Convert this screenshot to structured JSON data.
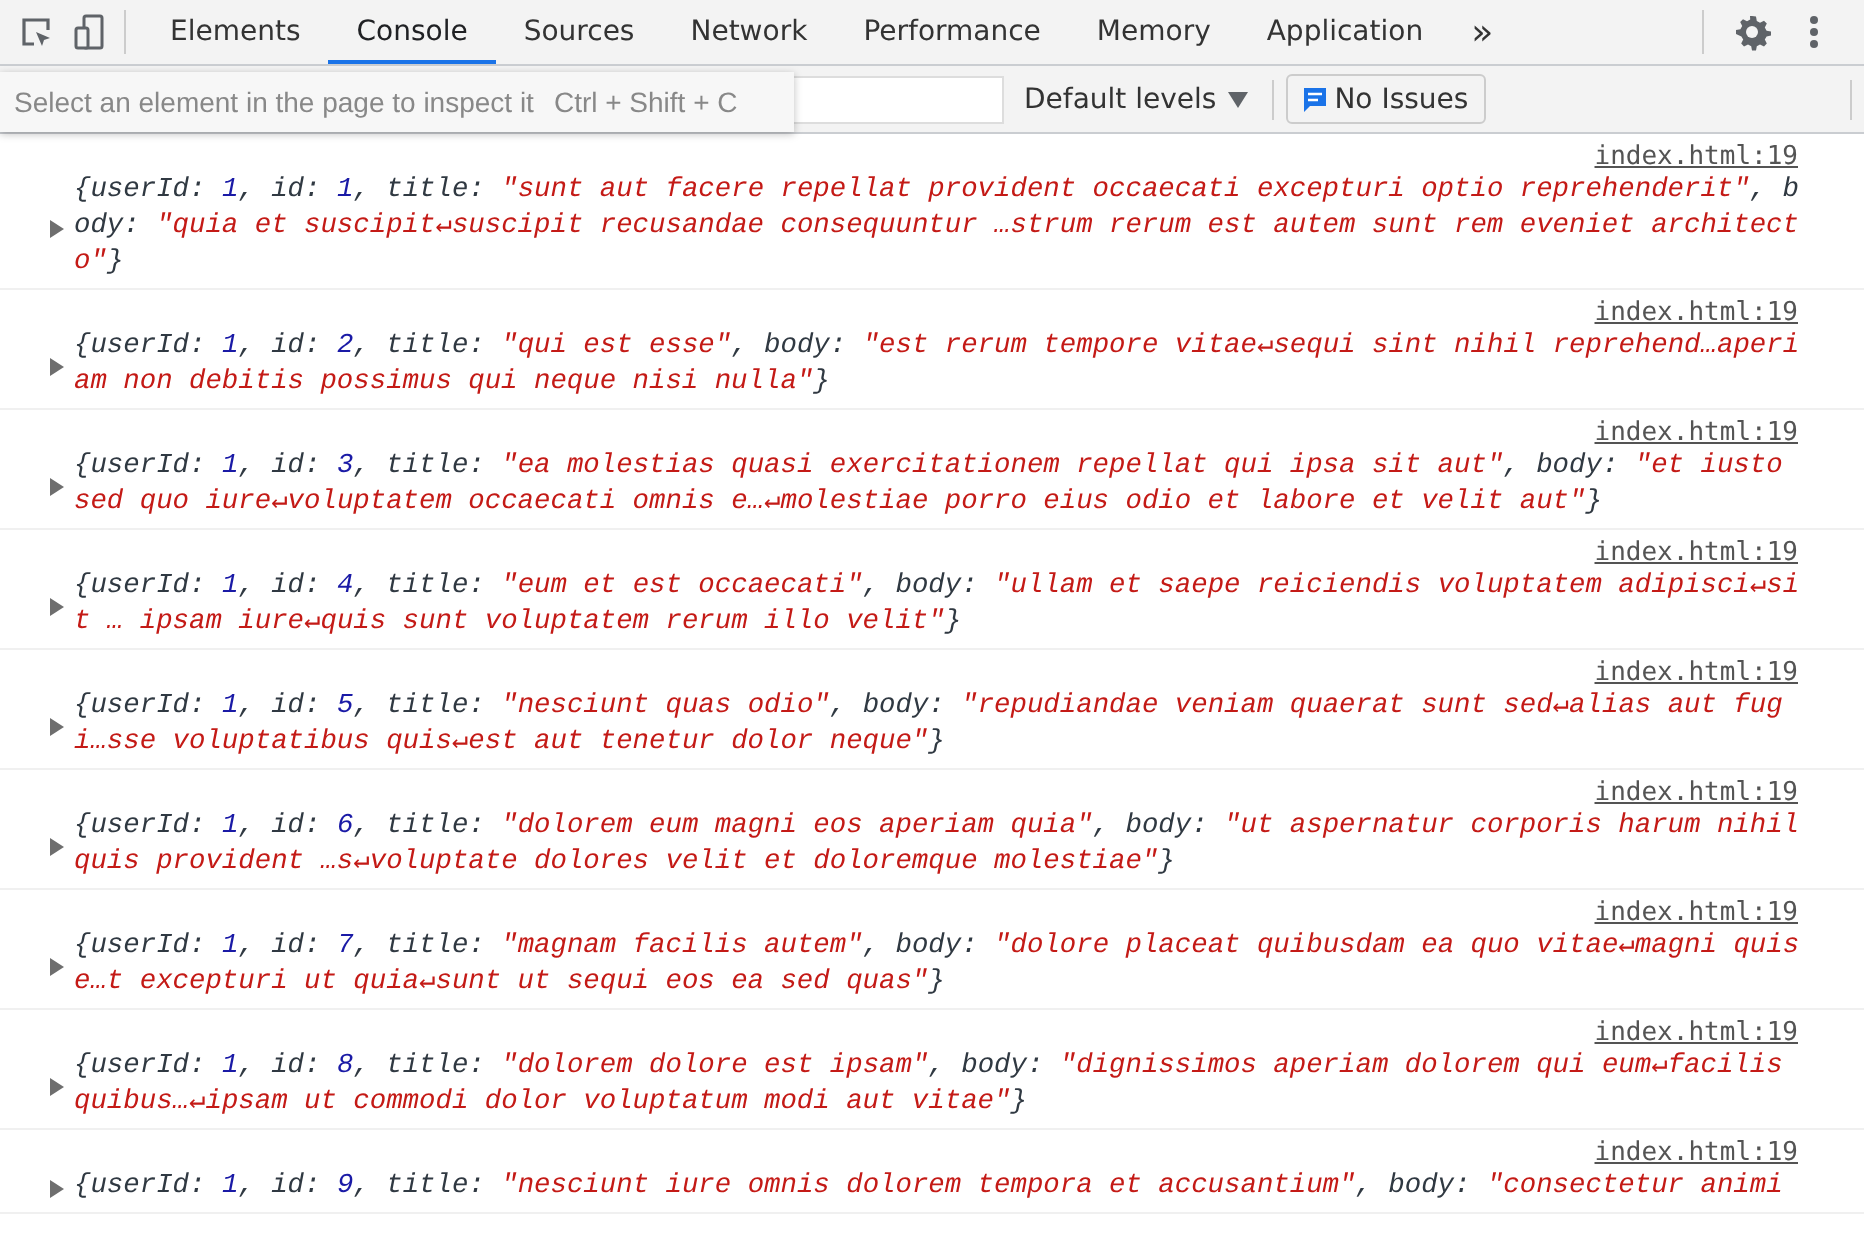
{
  "tabs": [
    {
      "label": "Elements",
      "selected": false
    },
    {
      "label": "Console",
      "selected": true
    },
    {
      "label": "Sources",
      "selected": false
    },
    {
      "label": "Network",
      "selected": false
    },
    {
      "label": "Performance",
      "selected": false
    },
    {
      "label": "Memory",
      "selected": false
    },
    {
      "label": "Application",
      "selected": false
    }
  ],
  "overflow": "»",
  "toolbar": {
    "levels": "Default levels",
    "issues": "No Issues"
  },
  "tooltip": {
    "text": "Select an element in the page to inspect it",
    "shortcut": "Ctrl + Shift + C"
  },
  "messages": [
    {
      "source": "index.html:19",
      "parts": [
        {
          "kind": "key",
          "text": "{userId: "
        },
        {
          "kind": "number",
          "text": "1"
        },
        {
          "kind": "key",
          "text": ", id: "
        },
        {
          "kind": "number",
          "text": "1"
        },
        {
          "kind": "key",
          "text": ", title: "
        },
        {
          "kind": "string",
          "text": "\"sunt aut facere repellat provident occaecati excepturi optio reprehenderit\""
        },
        {
          "kind": "key",
          "text": ", body: "
        },
        {
          "kind": "string",
          "text": "\"quia et suscipit↵suscipit recusandae consequuntur …strum rerum est autem sunt rem eveniet architecto\""
        },
        {
          "kind": "key",
          "text": "}"
        }
      ]
    },
    {
      "source": "index.html:19",
      "parts": [
        {
          "kind": "key",
          "text": "{userId: "
        },
        {
          "kind": "number",
          "text": "1"
        },
        {
          "kind": "key",
          "text": ", id: "
        },
        {
          "kind": "number",
          "text": "2"
        },
        {
          "kind": "key",
          "text": ", title: "
        },
        {
          "kind": "string",
          "text": "\"qui est esse\""
        },
        {
          "kind": "key",
          "text": ", body: "
        },
        {
          "kind": "string",
          "text": "\"est rerum tempore vitae↵sequi sint nihil reprehend…aperiam non debitis possimus qui neque nisi nulla\""
        },
        {
          "kind": "key",
          "text": "}"
        }
      ]
    },
    {
      "source": "index.html:19",
      "parts": [
        {
          "kind": "key",
          "text": "{userId: "
        },
        {
          "kind": "number",
          "text": "1"
        },
        {
          "kind": "key",
          "text": ", id: "
        },
        {
          "kind": "number",
          "text": "3"
        },
        {
          "kind": "key",
          "text": ", title: "
        },
        {
          "kind": "string",
          "text": "\"ea molestias quasi exercitationem repellat qui ipsa sit aut\""
        },
        {
          "kind": "key",
          "text": ", body: "
        },
        {
          "kind": "string",
          "text": "\"et iusto sed quo iure↵voluptatem occaecati omnis e…↵molestiae porro eius odio et labore et velit aut\""
        },
        {
          "kind": "key",
          "text": "}"
        }
      ]
    },
    {
      "source": "index.html:19",
      "parts": [
        {
          "kind": "key",
          "text": "{userId: "
        },
        {
          "kind": "number",
          "text": "1"
        },
        {
          "kind": "key",
          "text": ", id: "
        },
        {
          "kind": "number",
          "text": "4"
        },
        {
          "kind": "key",
          "text": ", title: "
        },
        {
          "kind": "string",
          "text": "\"eum et est occaecati\""
        },
        {
          "kind": "key",
          "text": ", body: "
        },
        {
          "kind": "string",
          "text": "\"ullam et saepe reiciendis voluptatem adipisci↵sit … ipsam iure↵quis sunt voluptatem rerum illo velit\""
        },
        {
          "kind": "key",
          "text": "}"
        }
      ]
    },
    {
      "source": "index.html:19",
      "parts": [
        {
          "kind": "key",
          "text": "{userId: "
        },
        {
          "kind": "number",
          "text": "1"
        },
        {
          "kind": "key",
          "text": ", id: "
        },
        {
          "kind": "number",
          "text": "5"
        },
        {
          "kind": "key",
          "text": ", title: "
        },
        {
          "kind": "string",
          "text": "\"nesciunt quas odio\""
        },
        {
          "kind": "key",
          "text": ", body: "
        },
        {
          "kind": "string",
          "text": "\"repudiandae veniam quaerat sunt sed↵alias aut fugi…sse voluptatibus quis↵est aut tenetur dolor neque\""
        },
        {
          "kind": "key",
          "text": "}"
        }
      ]
    },
    {
      "source": "index.html:19",
      "parts": [
        {
          "kind": "key",
          "text": "{userId: "
        },
        {
          "kind": "number",
          "text": "1"
        },
        {
          "kind": "key",
          "text": ", id: "
        },
        {
          "kind": "number",
          "text": "6"
        },
        {
          "kind": "key",
          "text": ", title: "
        },
        {
          "kind": "string",
          "text": "\"dolorem eum magni eos aperiam quia\""
        },
        {
          "kind": "key",
          "text": ", body: "
        },
        {
          "kind": "string",
          "text": "\"ut aspernatur corporis harum nihil quis provident …s↵voluptate dolores velit et doloremque molestiae\""
        },
        {
          "kind": "key",
          "text": "}"
        }
      ]
    },
    {
      "source": "index.html:19",
      "parts": [
        {
          "kind": "key",
          "text": "{userId: "
        },
        {
          "kind": "number",
          "text": "1"
        },
        {
          "kind": "key",
          "text": ", id: "
        },
        {
          "kind": "number",
          "text": "7"
        },
        {
          "kind": "key",
          "text": ", title: "
        },
        {
          "kind": "string",
          "text": "\"magnam facilis autem\""
        },
        {
          "kind": "key",
          "text": ", body: "
        },
        {
          "kind": "string",
          "text": "\"dolore placeat quibusdam ea quo vitae↵magni quis e…t excepturi ut quia↵sunt ut sequi eos ea sed quas\""
        },
        {
          "kind": "key",
          "text": "}"
        }
      ]
    },
    {
      "source": "index.html:19",
      "parts": [
        {
          "kind": "key",
          "text": "{userId: "
        },
        {
          "kind": "number",
          "text": "1"
        },
        {
          "kind": "key",
          "text": ", id: "
        },
        {
          "kind": "number",
          "text": "8"
        },
        {
          "kind": "key",
          "text": ", title: "
        },
        {
          "kind": "string",
          "text": "\"dolorem dolore est ipsam\""
        },
        {
          "kind": "key",
          "text": ", body: "
        },
        {
          "kind": "string",
          "text": "\"dignissimos aperiam dolorem qui eum↵facilis quibus…↵ipsam ut commodi dolor voluptatum modi aut vitae\""
        },
        {
          "kind": "key",
          "text": "}"
        }
      ]
    },
    {
      "source": "index.html:19",
      "parts": [
        {
          "kind": "key",
          "text": "{userId: "
        },
        {
          "kind": "number",
          "text": "1"
        },
        {
          "kind": "key",
          "text": ", id: "
        },
        {
          "kind": "number",
          "text": "9"
        },
        {
          "kind": "key",
          "text": ", title: "
        },
        {
          "kind": "string",
          "text": "\"nesciunt iure omnis dolorem tempora et accusantium\""
        },
        {
          "kind": "key",
          "text": ", body: "
        },
        {
          "kind": "string",
          "text": "\"consectetur animi"
        }
      ]
    }
  ]
}
